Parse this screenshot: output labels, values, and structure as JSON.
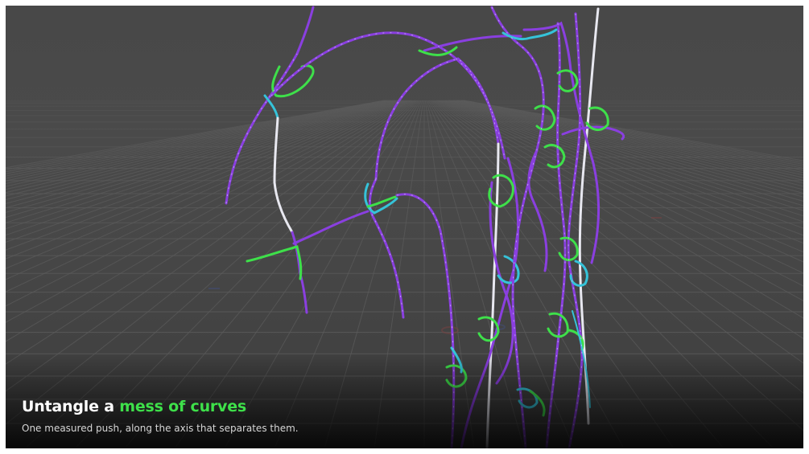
{
  "caption": {
    "title_prefix": "Untangle a ",
    "title_highlight": "mess of curves",
    "subtitle": "One measured push, along the axis that separates them."
  },
  "colors": {
    "viewport_bg": "#484848",
    "grid_line": "#5b5b5b",
    "curve_primary": "#8a3fe0",
    "curve_dash": "#c7b6f2",
    "collision_green": "#3ee04a",
    "collision_cyan": "#35c3d9",
    "selected_white": "#e8e8f0",
    "title_highlight": "#3ee04a"
  },
  "icons": [
    "grid-floor-icon",
    "curve-strand-icon"
  ]
}
